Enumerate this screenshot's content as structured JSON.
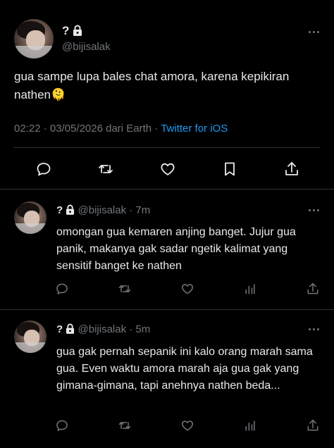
{
  "main_tweet": {
    "name": "?",
    "handle": "@bijisalak",
    "text": "gua sampe lupa bales chat amora, karena kepikiran nathen🫠",
    "meta_time": "02:22 · 03/05/2026 dari Earth · ",
    "meta_source": "Twitter for iOS",
    "action_icons": [
      "reply-icon",
      "retweet-icon",
      "like-icon",
      "bookmark-icon",
      "share-icon"
    ]
  },
  "replies": [
    {
      "name": "?",
      "handle_time": "@bijisalak · 7m",
      "text": "omongan gua kemaren anjing banget. Jujur gua panik, makanya gak sadar ngetik kalimat yang sensitif banget ke nathen",
      "action_icons": [
        "reply-icon",
        "retweet-icon",
        "like-icon",
        "analytics-icon",
        "share-icon"
      ]
    },
    {
      "name": "?",
      "handle_time": "@bijisalak · 5m",
      "text": "gua gak pernah sepanik ini kalo orang marah sama gua. Even waktu amora marah aja gua gak yang gimana-gimana, tapi anehnya nathen beda...",
      "action_icons": [
        "reply-icon",
        "retweet-icon",
        "like-icon",
        "analytics-icon",
        "share-icon"
      ]
    }
  ],
  "colors": {
    "background": "#000000",
    "text": "#e7e9ea",
    "muted": "#71767b",
    "link": "#1d9bf0",
    "divider": "#2f3336"
  }
}
